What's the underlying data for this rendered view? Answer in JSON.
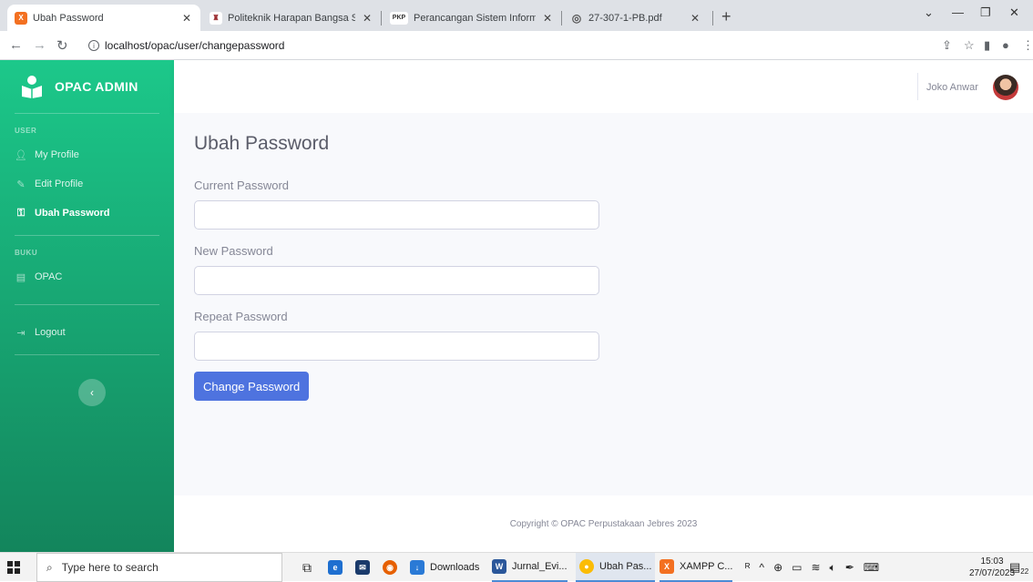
{
  "browser": {
    "tabs": [
      {
        "title": "Ubah Password",
        "fav_text": "X",
        "fav_color": "#f37021",
        "active": true
      },
      {
        "title": "Politeknik Harapan Bangsa Surak",
        "fav_text": "P",
        "fav_color": "#9b2d30",
        "active": false
      },
      {
        "title": "Perancangan Sistem Informasi Pe",
        "fav_text": "PKP",
        "fav_color": "#ffffff",
        "active": false
      },
      {
        "title": "27-307-1-PB.pdf",
        "fav_text": "◎",
        "fav_color": "#555555",
        "active": false
      }
    ],
    "new_tab_label": "+",
    "url": "localhost/opac/user/changepassword"
  },
  "sidebar": {
    "brand": "OPAC ADMIN",
    "sections": {
      "user_heading": "USER",
      "buku_heading": "BUKU"
    },
    "items": {
      "my_profile": "My Profile",
      "edit_profile": "Edit Profile",
      "ubah_password": "Ubah Password",
      "opac": "OPAC",
      "logout": "Logout"
    },
    "toggle_label": "‹"
  },
  "topbar": {
    "user_name": "Joko Anwar"
  },
  "page": {
    "title": "Ubah Password",
    "fields": {
      "current_label": "Current Password",
      "new_label": "New Password",
      "repeat_label": "Repeat Password"
    },
    "submit_label": "Change Password"
  },
  "footer": {
    "copyright": "Copyright © OPAC Perpustakaan Jebres 2023"
  },
  "taskbar": {
    "search_placeholder": "Type here to search",
    "apps": {
      "downloads": "Downloads",
      "jurnal": "Jurnal_Evi...",
      "chrome": "Ubah Pas...",
      "xampp": "XAMPP C..."
    },
    "time": "15:03",
    "date": "27/07/2023",
    "notifications": "22"
  },
  "colors": {
    "sidebar_top": "#1cc88a",
    "sidebar_bottom": "#13855c",
    "primary_button": "#4e73df"
  }
}
